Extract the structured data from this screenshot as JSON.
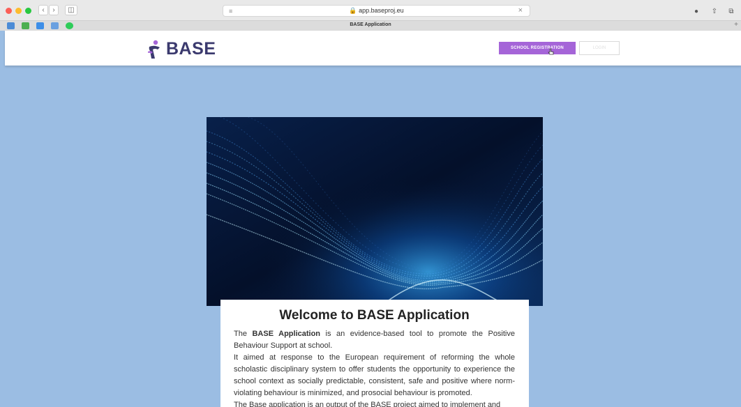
{
  "browser": {
    "url": "app.baseproj.eu",
    "tab_title": "BASE Application",
    "back_icon": "chevron-left-icon",
    "forward_icon": "chevron-right-icon"
  },
  "header": {
    "logo_text": "BASE",
    "school_registration_label": "SCHOOL REGISTRATION",
    "login_label": "LOGIN"
  },
  "card": {
    "title": "Welcome to BASE Application",
    "p1_lead": "The ",
    "p1_bold": "BASE Application",
    "p1_rest": " is an evidence-based tool to promote the Positive Behaviour Support at school.",
    "p2": "It aimed at response to the European requirement of reforming the whole scholastic disciplinary system to offer students the opportunity to experience the school context as socially predictable, consistent, safe and positive where norm-violating behaviour is minimized, and prosocial behaviour is promoted.",
    "p3": "The Base application is an output of the BASE project aimed to implement and"
  },
  "colors": {
    "accent": "#a565d8",
    "page_bg": "#9bbde3",
    "logo": "#3b3a6e"
  }
}
